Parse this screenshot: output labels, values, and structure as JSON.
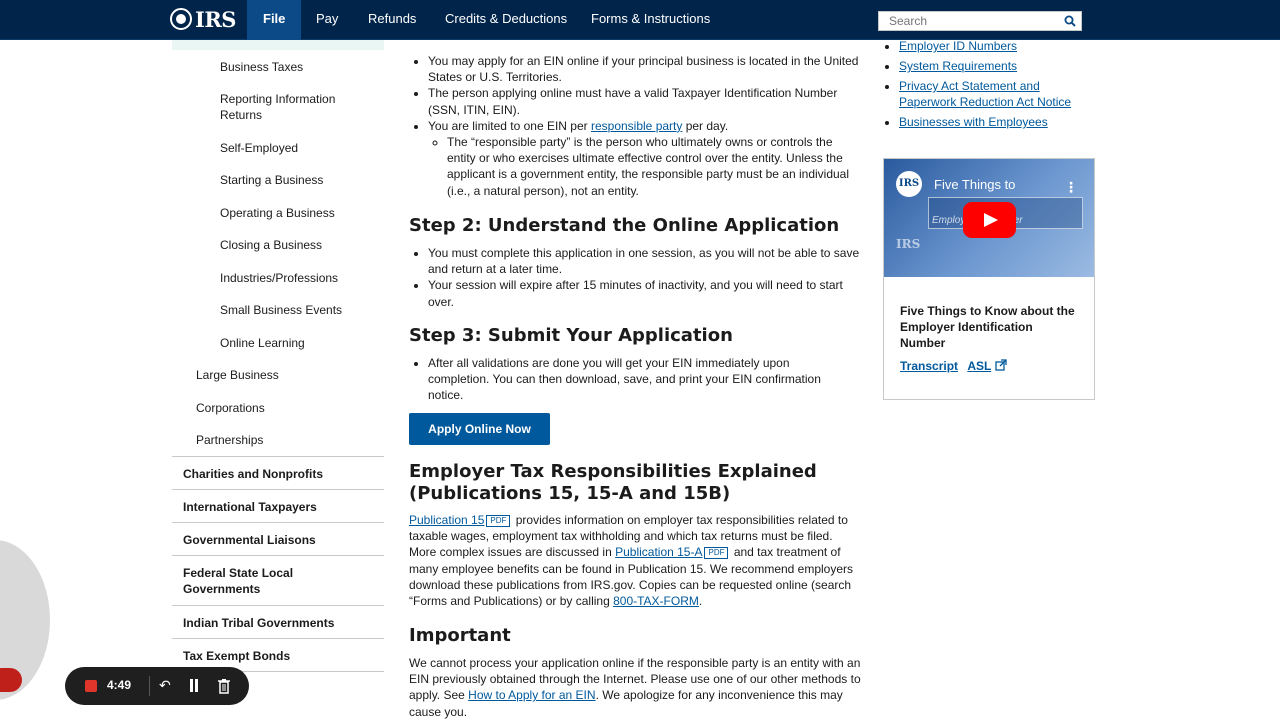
{
  "nav": {
    "logo": "IRS",
    "items": [
      {
        "label": "File",
        "active": true
      },
      {
        "label": "Pay"
      },
      {
        "label": "Refunds"
      },
      {
        "label": "Credits & Deductions"
      },
      {
        "label": "Forms & Instructions"
      }
    ],
    "search_placeholder": "Search"
  },
  "sidebar": {
    "sub_items": [
      "Business Taxes",
      "Reporting Information Returns",
      "Self-Employed",
      "Starting a Business",
      "Operating a Business",
      "Closing a Business",
      "Industries/Professions",
      "Small Business Events",
      "Online Learning"
    ],
    "items": [
      "Large Business",
      "Corporations",
      "Partnerships"
    ],
    "sections": [
      "Charities and Nonprofits",
      "International Taxpayers",
      "Governmental Liaisons",
      "Federal State Local Governments",
      "Indian Tribal Governments",
      "Tax Exempt Bonds"
    ]
  },
  "main": {
    "step1_bullets": [
      "You may apply for an EIN online if your principal business is located in the United States or U.S. Territories.",
      "The person applying online must have a valid Taxpayer Identification Number (SSN, ITIN, EIN)."
    ],
    "step1_limit_pre": "You are limited to one EIN per ",
    "step1_limit_link": "responsible party",
    "step1_limit_post": " per day.",
    "step1_sub": "The “responsible party” is the person who ultimately owns or controls the entity or who exercises ultimate effective control over the entity. Unless the applicant is a government entity, the responsible party must be an individual (i.e., a natural person), not an entity.",
    "step2_title": "Step 2: Understand the Online Application",
    "step2_bullets": [
      "You must complete this application in one session, as you will not be able to save and return at a later time.",
      "Your session will expire after 15 minutes of inactivity, and you will need to start over."
    ],
    "step3_title": "Step 3: Submit Your Application",
    "step3_bullets": [
      "After all validations are done you will get your EIN immediately upon completion. You can then download, save, and print your EIN confirmation notice."
    ],
    "apply_button": "Apply Online Now",
    "employer_title": "Employer Tax Responsibilities Explained (Publications 15, 15-A and 15B)",
    "pub15_link": "Publication 15",
    "pdf_label": "PDF",
    "employer_text1": " provides information on employer tax responsibilities related to taxable wages, employment tax withholding and which tax returns must be filed.  More complex issues are discussed in ",
    "pub15a_link": "Publication 15-A",
    "employer_text2": " and tax treatment of many employee benefits can be found in Publication 15. We recommend employers download these publications from IRS.gov.  Copies can be requested online (search “Forms and Publications) or by calling ",
    "phone_link": "800-TAX-FORM",
    "employer_text3": ".",
    "important_title": "Important",
    "important_text1": "We cannot process your application online if the responsible party is an entity with an EIN previously obtained through the Internet. Please use one of our other methods to apply. See ",
    "important_link": "How to Apply for an EIN",
    "important_text2": ". We apologize for any inconvenience this may cause you."
  },
  "right": {
    "links": [
      "Employer ID Numbers",
      "System Requirements",
      "Privacy Act Statement and Paperwork Reduction Act Notice",
      "Businesses with Employees"
    ],
    "video_title": "Five Things to",
    "video_subtitle": "Employ         tion Number",
    "video_logo": "IRS",
    "video_caption": "Five Things to Know about the Employer Identification Number",
    "transcript": "Transcript",
    "asl": "ASL"
  },
  "recorder": {
    "time": "4:49"
  }
}
